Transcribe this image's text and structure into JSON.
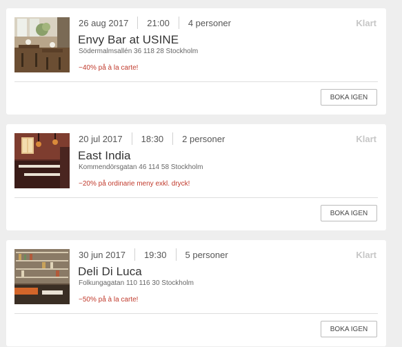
{
  "bookings": [
    {
      "date": "26 aug 2017",
      "time": "21:00",
      "guests": "4 personer",
      "status": "Klart",
      "name": "Envy Bar at USINE",
      "address": "Södermalmsallén 36 118 28 Stockholm",
      "offer": "−40% på à la carte!",
      "button": "BOKA IGEN",
      "image": "restaurant-photo-icon"
    },
    {
      "date": "20 jul 2017",
      "time": "18:30",
      "guests": "2 personer",
      "status": "Klart",
      "name": "East India",
      "address": "Kommendörsgatan 46 114 58 Stockholm",
      "offer": "−20% på ordinarie meny exkl. dryck!",
      "button": "BOKA IGEN",
      "image": "restaurant-photo-icon"
    },
    {
      "date": "30 jun 2017",
      "time": "19:30",
      "guests": "5 personer",
      "status": "Klart",
      "name": "Deli Di Luca",
      "address": "Folkungagatan 110 116 30 Stockholm",
      "offer": "−50% på à la carte!",
      "button": "BOKA IGEN",
      "image": "restaurant-photo-icon"
    }
  ],
  "colors": {
    "offer": "#c0392b",
    "status": "#c6c6c6",
    "background": "#eeeeee"
  }
}
